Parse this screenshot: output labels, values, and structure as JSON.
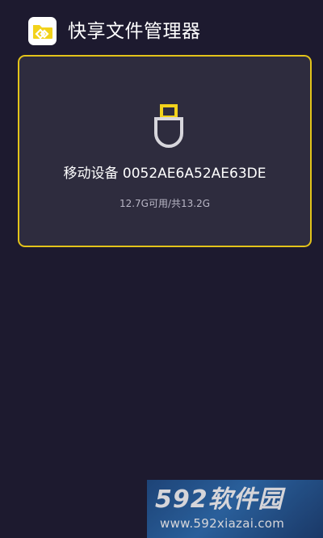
{
  "header": {
    "title": "快享文件管理器",
    "icon": "folder-link-icon",
    "icon_color": "#f2d21b"
  },
  "device": {
    "icon": "usb-drive-icon",
    "name": "移动设备 0052AE6A52AE63DE",
    "storage": "12.7G可用/共13.2G",
    "available_gb": 12.7,
    "total_gb": 13.2,
    "border_color": "#e3c31a"
  },
  "watermark": {
    "brand": "592软件园",
    "url": "www.592xiazai.com"
  },
  "colors": {
    "background": "#1d1a2f",
    "card": "#2e2c3e",
    "accent": "#f2d21b"
  }
}
